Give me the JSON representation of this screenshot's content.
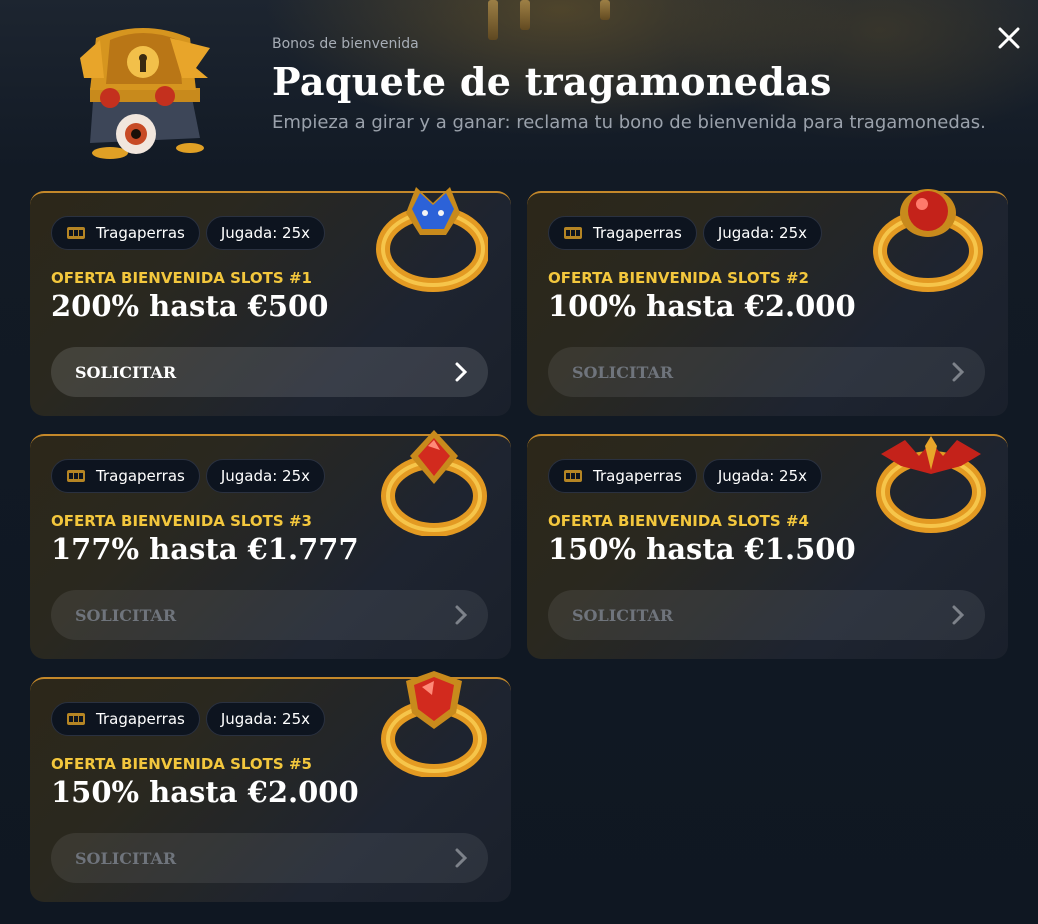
{
  "header": {
    "eyebrow": "Bonos de bienvenida",
    "title": "Paquete de tragamonedas",
    "subtitle": "Empieza a girar y a ganar: reclama tu bono de bienvenida para tragamonedas."
  },
  "icons": {
    "hero": "treasure-chest-icon",
    "close": "close-icon",
    "tag": "slot-machine-icon",
    "claim": "chevron-right-icon"
  },
  "colors": {
    "accent_gold": "#f3c73d",
    "card_border": "#c4882a",
    "background": "#111a26"
  },
  "offers": [
    {
      "tag_type": "Tragaperras",
      "tag_wager": "Jugada: 25x",
      "label": "OFERTA BIENVENIDA SLOTS #1",
      "value": "200% hasta €500",
      "button": "SOLICITAR",
      "ring": "blue-demon-ring"
    },
    {
      "tag_type": "Tragaperras",
      "tag_wager": "Jugada: 25x",
      "label": "OFERTA BIENVENIDA SLOTS #2",
      "value": "100% hasta €2.000",
      "button": "SOLICITAR",
      "ring": "red-orb-ring"
    },
    {
      "tag_type": "Tragaperras",
      "tag_wager": "Jugada: 25x",
      "label": "OFERTA BIENVENIDA SLOTS #3",
      "value": "177% hasta €1.777",
      "button": "SOLICITAR",
      "ring": "red-gem-ring"
    },
    {
      "tag_type": "Tragaperras",
      "tag_wager": "Jugada: 25x",
      "label": "OFERTA BIENVENIDA SLOTS #4",
      "value": "150% hasta €1.500",
      "button": "SOLICITAR",
      "ring": "bat-wing-ring"
    },
    {
      "tag_type": "Tragaperras",
      "tag_wager": "Jugada: 25x",
      "label": "OFERTA BIENVENIDA SLOTS #5",
      "value": "150% hasta €2.000",
      "button": "SOLICITAR",
      "ring": "red-shield-gem-ring"
    }
  ]
}
